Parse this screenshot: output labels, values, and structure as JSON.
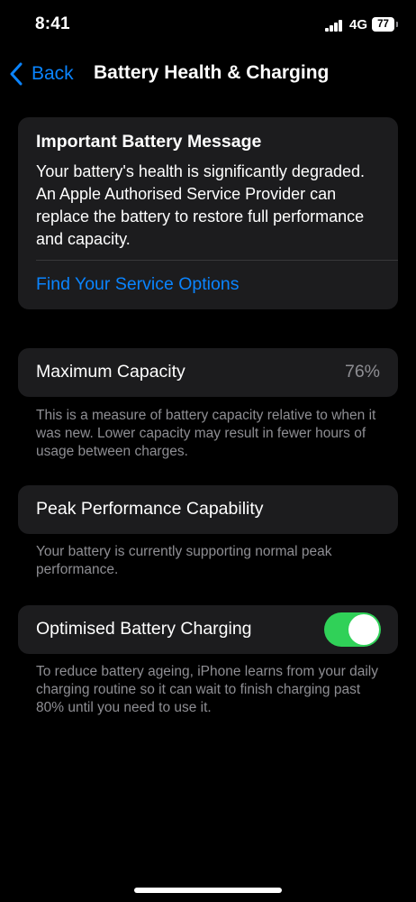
{
  "status_bar": {
    "time": "8:41",
    "network": "4G",
    "battery": "77"
  },
  "nav": {
    "back_label": "Back",
    "title": "Battery Health & Charging"
  },
  "message": {
    "title": "Important Battery Message",
    "body": "Your battery's health is significantly degraded. An Apple Authorised Service Provider can replace the battery to restore full performance and capacity.",
    "link": "Find Your Service Options"
  },
  "capacity": {
    "label": "Maximum Capacity",
    "value": "76%",
    "footnote": "This is a measure of battery capacity relative to when it was new. Lower capacity may result in fewer hours of usage between charges."
  },
  "peak": {
    "label": "Peak Performance Capability",
    "footnote": "Your battery is currently supporting normal peak performance."
  },
  "optimised": {
    "label": "Optimised Battery Charging",
    "enabled": true,
    "footnote": "To reduce battery ageing, iPhone learns from your daily charging routine so it can wait to finish charging past 80% until you need to use it."
  },
  "colors": {
    "accent": "#0a84ff",
    "toggle_on": "#30d158",
    "card": "#1c1c1e",
    "secondary_text": "#8e8e93"
  }
}
